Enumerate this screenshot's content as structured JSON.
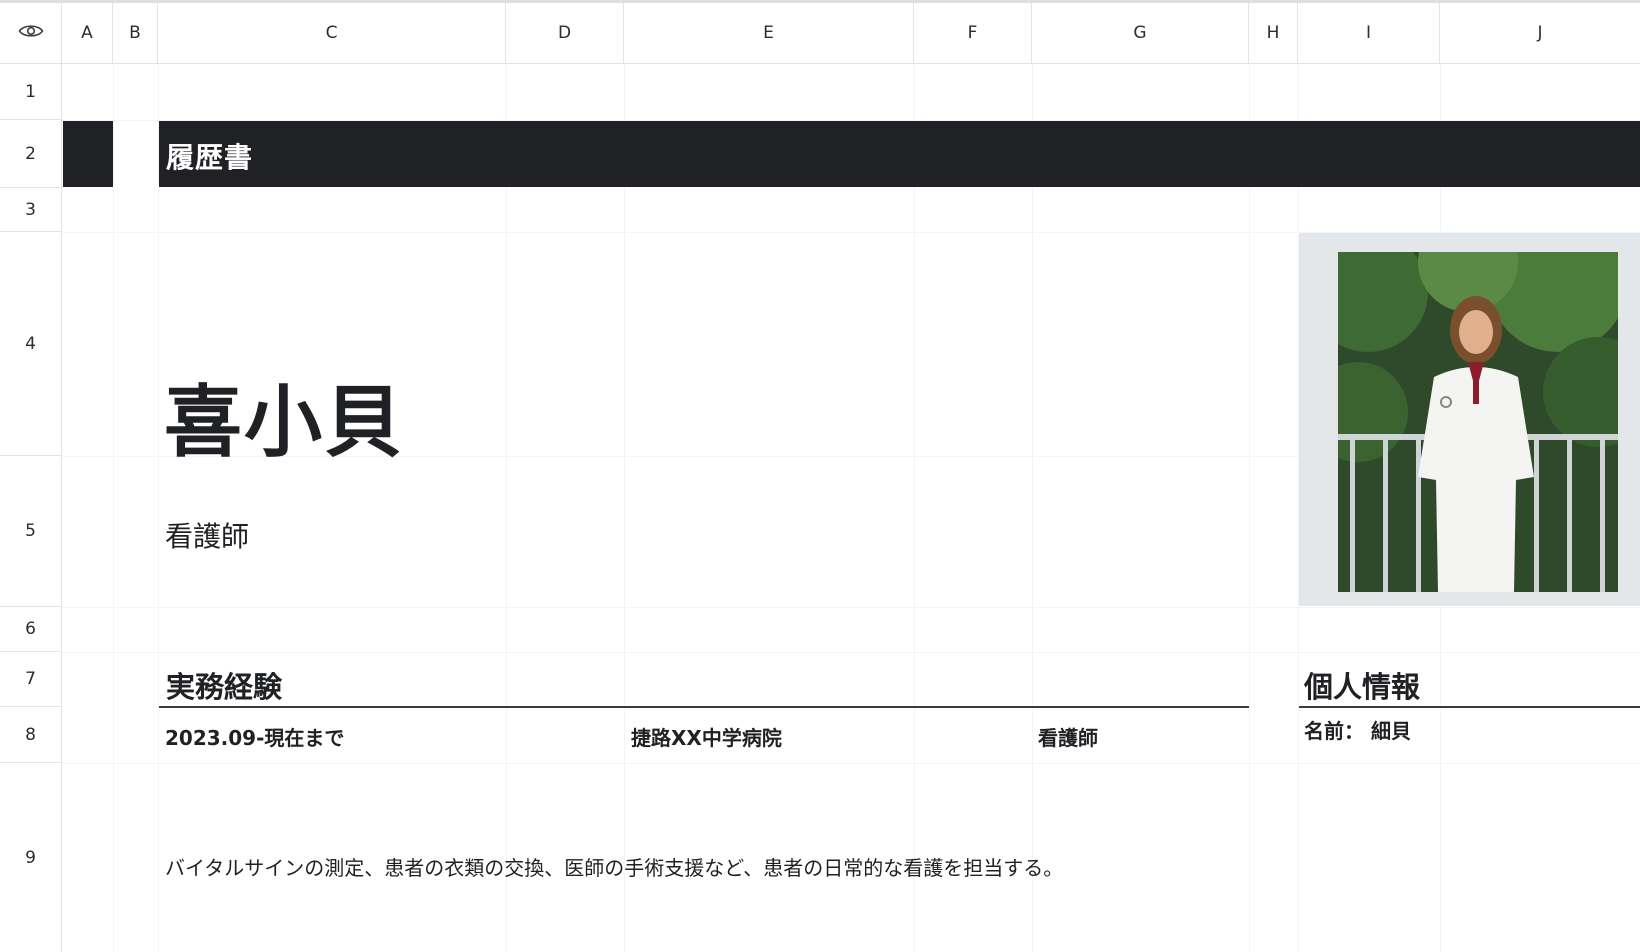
{
  "columns": [
    "A",
    "B",
    "C",
    "D",
    "E",
    "F",
    "G",
    "H",
    "I",
    "J"
  ],
  "rows": [
    "1",
    "2",
    "3",
    "4",
    "5",
    "6",
    "7",
    "8",
    "9"
  ],
  "header_icon": "eye-icon",
  "resume": {
    "title": "履歴書",
    "name": "喜小貝",
    "occupation": "看護師",
    "experience_heading": "実務経験",
    "experience": [
      {
        "period": "2023.09-現在まで",
        "employer": "捷路XX中学病院",
        "role": "看護師",
        "description": "バイタルサインの測定、患者の衣類の交換、医師の手術支援など、患者の日常的な看護を担当する。"
      }
    ],
    "personal_heading": "個人情報",
    "personal_name": "名前： 細貝"
  },
  "colors": {
    "banner": "#1f2124",
    "grid": "#e2e4e7",
    "photo_frame": "#e3e7ea",
    "text": "#1f2124"
  }
}
